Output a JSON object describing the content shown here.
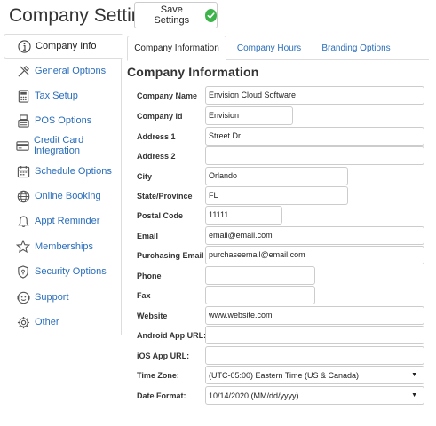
{
  "header": {
    "title": "Company Settings",
    "save_label": "Save Settings"
  },
  "sidebar": {
    "items": [
      {
        "label": "Company Info",
        "icon": "info-icon",
        "active": true
      },
      {
        "label": "General Options",
        "icon": "tools-icon"
      },
      {
        "label": "Tax Setup",
        "icon": "calculator-icon"
      },
      {
        "label": "POS Options",
        "icon": "register-icon"
      },
      {
        "label": "Credit Card Integration",
        "icon": "credit-card-icon"
      },
      {
        "label": "Schedule Options",
        "icon": "calendar-icon"
      },
      {
        "label": "Online Booking",
        "icon": "globe-icon"
      },
      {
        "label": "Appt Reminder",
        "icon": "bell-icon"
      },
      {
        "label": "Memberships",
        "icon": "star-icon"
      },
      {
        "label": "Security Options",
        "icon": "shield-icon"
      },
      {
        "label": "Support",
        "icon": "support-icon"
      },
      {
        "label": "Other",
        "icon": "gear-icon"
      }
    ]
  },
  "tabs": [
    {
      "label": "Company Information",
      "active": true
    },
    {
      "label": "Company Hours"
    },
    {
      "label": "Branding Options"
    }
  ],
  "section_title": "Company Information",
  "form": {
    "company_name": {
      "label": "Company Name",
      "value": "Envision Cloud Software"
    },
    "company_id": {
      "label": "Company Id",
      "value": "Envision"
    },
    "address1": {
      "label": "Address 1",
      "value": "Street Dr"
    },
    "address2": {
      "label": "Address 2",
      "value": ""
    },
    "city": {
      "label": "City",
      "value": "Orlando"
    },
    "state": {
      "label": "State/Province",
      "value": "FL"
    },
    "postal": {
      "label": "Postal Code",
      "value": "11111"
    },
    "email": {
      "label": "Email",
      "value": "email@email.com"
    },
    "purchase_email": {
      "label": "Purchasing Email",
      "value": "purchaseemail@email.com"
    },
    "phone": {
      "label": "Phone",
      "value": ""
    },
    "fax": {
      "label": "Fax",
      "value": ""
    },
    "website": {
      "label": "Website",
      "value": "www.website.com"
    },
    "android_url": {
      "label": "Android App URL:",
      "value": ""
    },
    "ios_url": {
      "label": "iOS App URL:",
      "value": ""
    },
    "timezone": {
      "label": "Time Zone:",
      "value": "(UTC-05:00) Eastern Time (US & Canada)"
    },
    "date_format": {
      "label": "Date Format:",
      "value": "10/14/2020 (MM/dd/yyyy)"
    }
  },
  "colors": {
    "link": "#2a6ebb",
    "save_check": "#3cb44b",
    "border": "#cccccc"
  }
}
